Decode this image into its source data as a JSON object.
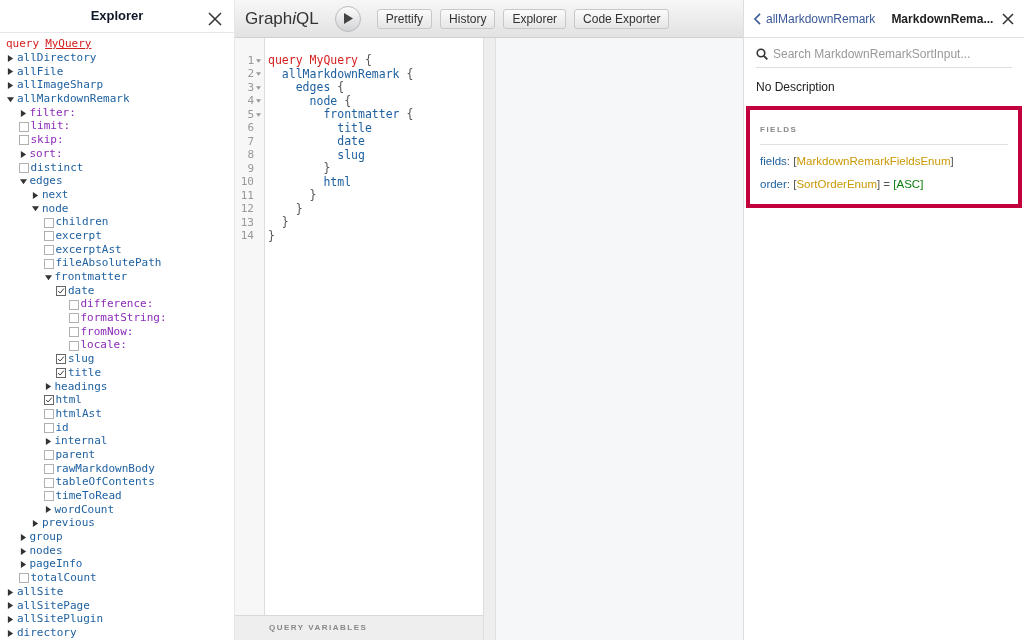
{
  "explorer": {
    "title": "Explorer",
    "query_keyword": "query",
    "operation_name": "MyQuery",
    "tree": [
      {
        "label": "allDirectory",
        "kind": "toggle",
        "arg": false,
        "expanded": false
      },
      {
        "label": "allFile",
        "kind": "toggle",
        "arg": false,
        "expanded": false
      },
      {
        "label": "allImageSharp",
        "kind": "toggle",
        "arg": false,
        "expanded": false
      },
      {
        "label": "allMarkdownRemark",
        "kind": "toggle",
        "arg": false,
        "expanded": true,
        "children": [
          {
            "label": "filter:",
            "kind": "toggle",
            "arg": true,
            "expanded": false
          },
          {
            "label": "limit:",
            "kind": "check",
            "arg": true,
            "checked": false
          },
          {
            "label": "skip:",
            "kind": "check",
            "arg": true,
            "checked": false
          },
          {
            "label": "sort:",
            "kind": "toggle",
            "arg": true,
            "expanded": false
          },
          {
            "label": "distinct",
            "kind": "check",
            "arg": false,
            "checked": false
          },
          {
            "label": "edges",
            "kind": "toggle",
            "arg": false,
            "expanded": true,
            "children": [
              {
                "label": "next",
                "kind": "toggle",
                "arg": false,
                "expanded": false
              },
              {
                "label": "node",
                "kind": "toggle",
                "arg": false,
                "expanded": true,
                "children": [
                  {
                    "label": "children",
                    "kind": "check",
                    "arg": false,
                    "checked": false
                  },
                  {
                    "label": "excerpt",
                    "kind": "check",
                    "arg": false,
                    "checked": false
                  },
                  {
                    "label": "excerptAst",
                    "kind": "check",
                    "arg": false,
                    "checked": false
                  },
                  {
                    "label": "fileAbsolutePath",
                    "kind": "check",
                    "arg": false,
                    "checked": false
                  },
                  {
                    "label": "frontmatter",
                    "kind": "toggle",
                    "arg": false,
                    "expanded": true,
                    "children": [
                      {
                        "label": "date",
                        "kind": "check",
                        "arg": false,
                        "checked": true,
                        "children": [
                          {
                            "label": "difference:",
                            "kind": "check",
                            "arg": true,
                            "checked": false
                          },
                          {
                            "label": "formatString:",
                            "kind": "check",
                            "arg": true,
                            "checked": false
                          },
                          {
                            "label": "fromNow:",
                            "kind": "check",
                            "arg": true,
                            "checked": false
                          },
                          {
                            "label": "locale:",
                            "kind": "check",
                            "arg": true,
                            "checked": false
                          }
                        ]
                      },
                      {
                        "label": "slug",
                        "kind": "check",
                        "arg": false,
                        "checked": true
                      },
                      {
                        "label": "title",
                        "kind": "check",
                        "arg": false,
                        "checked": true
                      }
                    ]
                  },
                  {
                    "label": "headings",
                    "kind": "toggle",
                    "arg": false,
                    "expanded": false
                  },
                  {
                    "label": "html",
                    "kind": "check",
                    "arg": false,
                    "checked": true
                  },
                  {
                    "label": "htmlAst",
                    "kind": "check",
                    "arg": false,
                    "checked": false
                  },
                  {
                    "label": "id",
                    "kind": "check",
                    "arg": false,
                    "checked": false
                  },
                  {
                    "label": "internal",
                    "kind": "toggle",
                    "arg": false,
                    "expanded": false
                  },
                  {
                    "label": "parent",
                    "kind": "check",
                    "arg": false,
                    "checked": false
                  },
                  {
                    "label": "rawMarkdownBody",
                    "kind": "check",
                    "arg": false,
                    "checked": false
                  },
                  {
                    "label": "tableOfContents",
                    "kind": "check",
                    "arg": false,
                    "checked": false
                  },
                  {
                    "label": "timeToRead",
                    "kind": "check",
                    "arg": false,
                    "checked": false
                  },
                  {
                    "label": "wordCount",
                    "kind": "toggle",
                    "arg": false,
                    "expanded": false
                  }
                ]
              },
              {
                "label": "previous",
                "kind": "toggle",
                "arg": false,
                "expanded": false
              }
            ]
          },
          {
            "label": "group",
            "kind": "toggle",
            "arg": false,
            "expanded": false
          },
          {
            "label": "nodes",
            "kind": "toggle",
            "arg": false,
            "expanded": false
          },
          {
            "label": "pageInfo",
            "kind": "toggle",
            "arg": false,
            "expanded": false
          },
          {
            "label": "totalCount",
            "kind": "check",
            "arg": false,
            "checked": false
          }
        ]
      },
      {
        "label": "allSite",
        "kind": "toggle",
        "arg": false,
        "expanded": false
      },
      {
        "label": "allSitePage",
        "kind": "toggle",
        "arg": false,
        "expanded": false
      },
      {
        "label": "allSitePlugin",
        "kind": "toggle",
        "arg": false,
        "expanded": false
      },
      {
        "label": "directory",
        "kind": "toggle",
        "arg": false,
        "expanded": false
      }
    ]
  },
  "toolbar": {
    "logo": [
      {
        "text": "Graph",
        "italic": false
      },
      {
        "text": "i",
        "italic": true
      },
      {
        "text": "QL",
        "italic": false
      }
    ],
    "buttons": [
      "Prettify",
      "History",
      "Explorer",
      "Code Exporter"
    ]
  },
  "editor": {
    "lines": [
      {
        "number": "1",
        "foldable": true,
        "tokens": [
          {
            "kind": "keyword",
            "text": "query"
          },
          {
            "kind": "def",
            "text": " MyQuery"
          },
          {
            "kind": "punct",
            "text": " {"
          }
        ]
      },
      {
        "number": "2",
        "foldable": true,
        "tokens": [
          {
            "kind": "field",
            "text": "  allMarkdownRemark"
          },
          {
            "kind": "punct",
            "text": " {"
          }
        ]
      },
      {
        "number": "3",
        "foldable": true,
        "tokens": [
          {
            "kind": "field",
            "text": "    edges"
          },
          {
            "kind": "punct",
            "text": " {"
          }
        ]
      },
      {
        "number": "4",
        "foldable": true,
        "tokens": [
          {
            "kind": "field",
            "text": "      node"
          },
          {
            "kind": "punct",
            "text": " {"
          }
        ]
      },
      {
        "number": "5",
        "foldable": true,
        "tokens": [
          {
            "kind": "field",
            "text": "        frontmatter"
          },
          {
            "kind": "punct",
            "text": " {"
          }
        ]
      },
      {
        "number": "6",
        "foldable": false,
        "tokens": [
          {
            "kind": "field",
            "text": "          title"
          }
        ]
      },
      {
        "number": "7",
        "foldable": false,
        "tokens": [
          {
            "kind": "field",
            "text": "          date"
          }
        ]
      },
      {
        "number": "8",
        "foldable": false,
        "tokens": [
          {
            "kind": "field",
            "text": "          slug"
          }
        ]
      },
      {
        "number": "9",
        "foldable": false,
        "tokens": [
          {
            "kind": "punct",
            "text": "        }"
          }
        ]
      },
      {
        "number": "10",
        "foldable": false,
        "tokens": [
          {
            "kind": "field",
            "text": "        html"
          }
        ]
      },
      {
        "number": "11",
        "foldable": false,
        "tokens": [
          {
            "kind": "punct",
            "text": "      }"
          }
        ]
      },
      {
        "number": "12",
        "foldable": false,
        "tokens": [
          {
            "kind": "punct",
            "text": "    }"
          }
        ]
      },
      {
        "number": "13",
        "foldable": false,
        "tokens": [
          {
            "kind": "punct",
            "text": "  }"
          }
        ]
      },
      {
        "number": "14",
        "foldable": false,
        "tokens": [
          {
            "kind": "punct",
            "text": "}"
          }
        ]
      }
    ],
    "footer": "QUERY VARIABLES"
  },
  "docs": {
    "back_link": "allMarkdownRemark",
    "title": "MarkdownRema...",
    "search": {
      "placeholder": "Search MarkdownRemarkSortInput..."
    },
    "description": "No Description",
    "section": {
      "title": "FIELDS",
      "highlighted": true,
      "fields": [
        {
          "tokens": [
            {
              "kind": "name",
              "text": "fields"
            },
            {
              "kind": "punct",
              "text": ": ["
            },
            {
              "kind": "type",
              "text": "MarkdownRemarkFieldsEnum"
            },
            {
              "kind": "punct",
              "text": "]"
            }
          ]
        },
        {
          "tokens": [
            {
              "kind": "name",
              "text": "order"
            },
            {
              "kind": "punct",
              "text": ": ["
            },
            {
              "kind": "type",
              "text": "SortOrderEnum"
            },
            {
              "kind": "punct",
              "text": "] = "
            },
            {
              "kind": "default",
              "text": "[ASC]"
            }
          ]
        }
      ]
    }
  }
}
